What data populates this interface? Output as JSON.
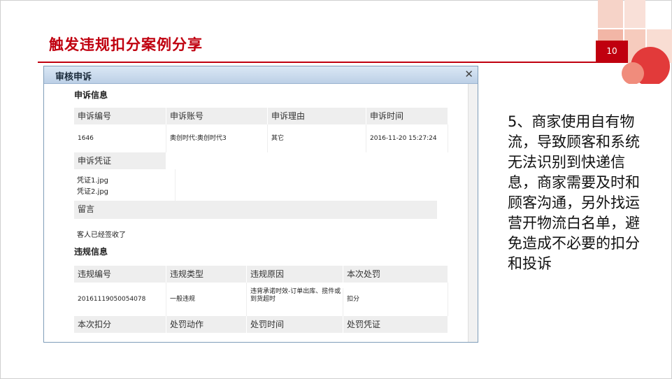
{
  "slide": {
    "title": "触发违规扣分案例分享",
    "page_number": "10",
    "accent_color": "#c0000f",
    "side_note": "5、商家使用自有物流，导致顾客和系统无法识别到快递信息，商家需要及时和顾客沟通，另外找运营开物流白名单，避免造成不必要的扣分和投诉"
  },
  "dialog": {
    "title": "审核申诉",
    "close_icon": "close-icon",
    "appeal_section": {
      "title": "申诉信息",
      "headers": [
        "申诉编号",
        "申诉账号",
        "申诉理由",
        "申诉时间"
      ],
      "values": [
        "1646",
        "奥创时代:奥创时代3",
        "其它",
        "2016-11-20 15:27:24"
      ],
      "evidence_label": "申诉凭证",
      "evidence_files": [
        "凭证1.jpg",
        "凭证2.jpg"
      ],
      "message_label": "留言",
      "message_text": "客人已经签收了"
    },
    "violation_section": {
      "title": "违规信息",
      "headers": [
        "违规编号",
        "违规类型",
        "违规原因",
        "本次处罚"
      ],
      "values": [
        "20161119050054078",
        "一般违规",
        "违背承诺时效-订单出库、揽件或到货超时",
        "扣分"
      ],
      "headers2": [
        "本次扣分",
        "处罚动作",
        "处罚时间",
        "处罚凭证"
      ]
    }
  }
}
